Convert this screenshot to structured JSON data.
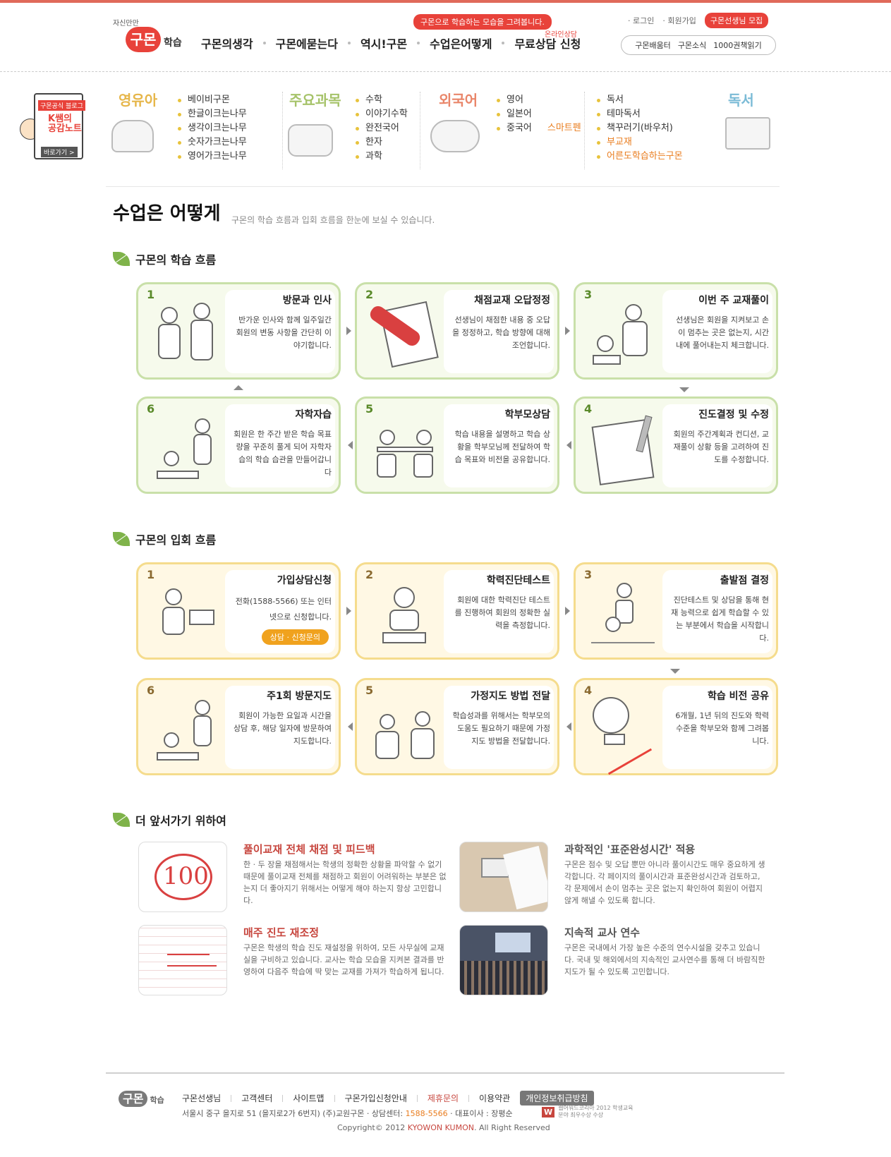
{
  "header": {
    "logo_tag": "자신만만",
    "logo_main": "구몬",
    "logo_sub": "학습",
    "promo": "구몬으로 학습하는 모습을 그려봅니다.",
    "online": "온라인상담",
    "gnb": [
      "구몬의생각",
      "구몬에묻는다",
      "역시!구몬",
      "수업은어떻게",
      "무료상담 신청"
    ],
    "util": {
      "login": "· 로그인",
      "join": "· 회원가입",
      "recruit": "구몬선생님 모집"
    },
    "quick": [
      "구몬배움터",
      "구몬소식",
      "1000권책읽기"
    ]
  },
  "blog": {
    "badge": "구몬공식 블로그",
    "title": "K쌤의 공감노트",
    "go": "바로가기 >"
  },
  "subnav": {
    "infant": {
      "title": "영유아",
      "items": [
        "베이비구몬",
        "한글이크는나무",
        "생각이크는나무",
        "숫자가크는나무",
        "영어가크는나무"
      ]
    },
    "main": {
      "title": "주요과목",
      "items": [
        "수학",
        "이야기수학",
        "완전국어",
        "한자",
        "과학"
      ]
    },
    "foreign": {
      "title": "외국어",
      "items": [
        "영어",
        "일본어",
        "중국어"
      ],
      "extra": "스마트펜"
    },
    "reading": {
      "title": "독서",
      "items": [
        "독서",
        "테마독서",
        "책꾸러기(바우처)",
        "부교재",
        "어른도학습하는구몬"
      ]
    }
  },
  "page": {
    "title": "수업은 어떻게",
    "desc": "구몬의 학습 흐름과 입회 흐름을 한눈에 보실 수 있습니다."
  },
  "study": {
    "heading": "구몬의 학습 흐름",
    "steps": [
      {
        "num": "1",
        "title": "방문과 인사",
        "desc": "반가운 인사와 함께 일주일간 회원의 변동 사항을 간단히 이야기합니다."
      },
      {
        "num": "2",
        "title": "채점교재 오답정정",
        "desc": "선생님이 채점한 내용 중 오답을 정정하고, 학습 방향에 대해 조언합니다."
      },
      {
        "num": "3",
        "title": "이번 주 교재풀이",
        "desc": "선생님은 회원을 지켜보고 손이 멈추는 곳은 없는지, 시간 내에 풀어내는지 체크합니다."
      },
      {
        "num": "6",
        "title": "자학자습",
        "desc": "회원은 한 주간 받은 학습 목표량을 꾸준히 풀게 되어 자학자습의 학습 습관을 만들어갑니다"
      },
      {
        "num": "5",
        "title": "학부모상담",
        "desc": "학습 내용을 설명하고 학습 상황을 학부모님께 전달하여 학습 목표와 비전을 공유합니다."
      },
      {
        "num": "4",
        "title": "진도결정 및 수정",
        "desc": "회원의 주간계획과 컨디션, 교재풀이 상황 등을 고려하여 진도를 수정합니다."
      }
    ]
  },
  "enroll": {
    "heading": "구몬의 입회 흐름",
    "steps": [
      {
        "num": "1",
        "title": "가입상담신청",
        "desc": "전화(1588-5566) 또는 인터넷으로 신청합니다.",
        "button": "상담 · 신청문의"
      },
      {
        "num": "2",
        "title": "학력진단테스트",
        "desc": "회원에 대한 학력진단 테스트를 진행하여 회원의 정확한 실력을 측정합니다."
      },
      {
        "num": "3",
        "title": "출발점 결정",
        "desc": "진단테스트 및 상담을 통해 현재 능력으로 쉽게 학습할 수 있는 부분에서 학습을 시작합니다."
      },
      {
        "num": "6",
        "title": "주1회 방문지도",
        "desc": "회원이 가능한 요일과 시간을 상담 후, 해당 일자에 방문하여 지도합니다."
      },
      {
        "num": "5",
        "title": "가정지도 방법 전달",
        "desc": "학습성과를 위해서는 학부모의 도움도 필요하기 때문에 가정지도 방법을 전달합니다."
      },
      {
        "num": "4",
        "title": "학습 비전 공유",
        "desc": "6개월, 1년 뒤의 진도와 학력 수준을 학부모와 함께 그려봅니다."
      }
    ]
  },
  "advance": {
    "heading": "더 앞서가기 위하여",
    "items": [
      {
        "title": "풀이교재 전체 채점 및 피드백",
        "desc": "한 · 두 장을 채점해서는 학생의 정확한 상황을 파악할 수 없기 때문에 풀이교재 전체를 채점하고 회원이 어려워하는 부분은 없는지 더 좋아지기 위해서는 어떻게 해야 하는지 항상 고민합니다.",
        "img_label": "100"
      },
      {
        "title": "과학적인 '표준완성시간' 적용",
        "desc": "구몬은 점수 및 오답 뿐만 아니라 풀이시간도 매우 중요하게 생각합니다. 각 페이지의 풀이시간과 표준완성시간과 검토하고, 각 문제에서 손이 멈추는 곳은 없는지 확인하여 회원이 어렵지 않게 해낼 수 있도록 합니다."
      },
      {
        "title": "매주 진도 재조정",
        "desc": "구몬은 학생의 학습 진도 재설정을 위하여, 모든 사무실에 교재실을 구비하고 있습니다. 교사는 학습 모습을 지켜본 결과를 반영하여 다음주 학습에 딱 맞는 교재를 가져가 학습하게 됩니다."
      },
      {
        "title": "지속적 교사 연수",
        "desc": "구몬은 국내에서 가장 높은 수준의 연수시설을 갖추고 있습니다. 국내 및 해외에서의 지속적인 교사연수를 통해 더 바람직한 지도가 될 수 있도록 고민합니다."
      }
    ]
  },
  "footer": {
    "logo": "구몬",
    "logo_sub": "학습",
    "links": [
      "구몬선생님",
      "고객센터",
      "사이트맵",
      "구몬가입신청안내",
      "제휴문의",
      "이용약관",
      "개인정보취급방침"
    ],
    "addr": "서울시 중구 을지로 51 (을지로2가 6번지) (주)교원구몬",
    "center_label": "상담센터:",
    "center": "1588-5566",
    "ceo": "대표이사 : 장평순",
    "award_logo": "W",
    "award": "웹어워드코리아 2012 학생교육분야 최우수상 수상",
    "copy1": "Copyright© 2012 ",
    "copy_brand": "KYOWON KUMON",
    "copy2": ". All Right Reserved"
  },
  "colors": {
    "brand": "#e8423a",
    "green_box": "#c9e0a9",
    "yellow_box": "#f5dc8d",
    "accent_orange": "#e97d1f"
  }
}
